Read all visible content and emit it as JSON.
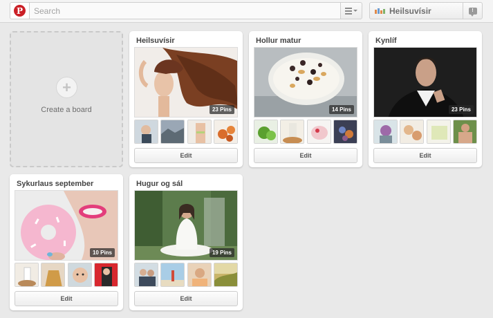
{
  "header": {
    "logo_letter": "P",
    "search_placeholder": "Search",
    "user_name": "Heilsuvísir"
  },
  "create_board": {
    "label": "Create a board"
  },
  "boards": [
    {
      "title": "Heilsuvísir",
      "pins": "23 Pins",
      "edit": "Edit"
    },
    {
      "title": "Hollur matur",
      "pins": "14 Pins",
      "edit": "Edit"
    },
    {
      "title": "Kynlíf",
      "pins": "23 Pins",
      "edit": "Edit"
    },
    {
      "title": "Sykurlaus september",
      "pins": "10 Pins",
      "edit": "Edit"
    },
    {
      "title": "Hugur og sál",
      "pins": "19 Pins",
      "edit": "Edit"
    }
  ],
  "colors": {
    "brand": "#cb2027",
    "background": "#e9e9e9"
  }
}
